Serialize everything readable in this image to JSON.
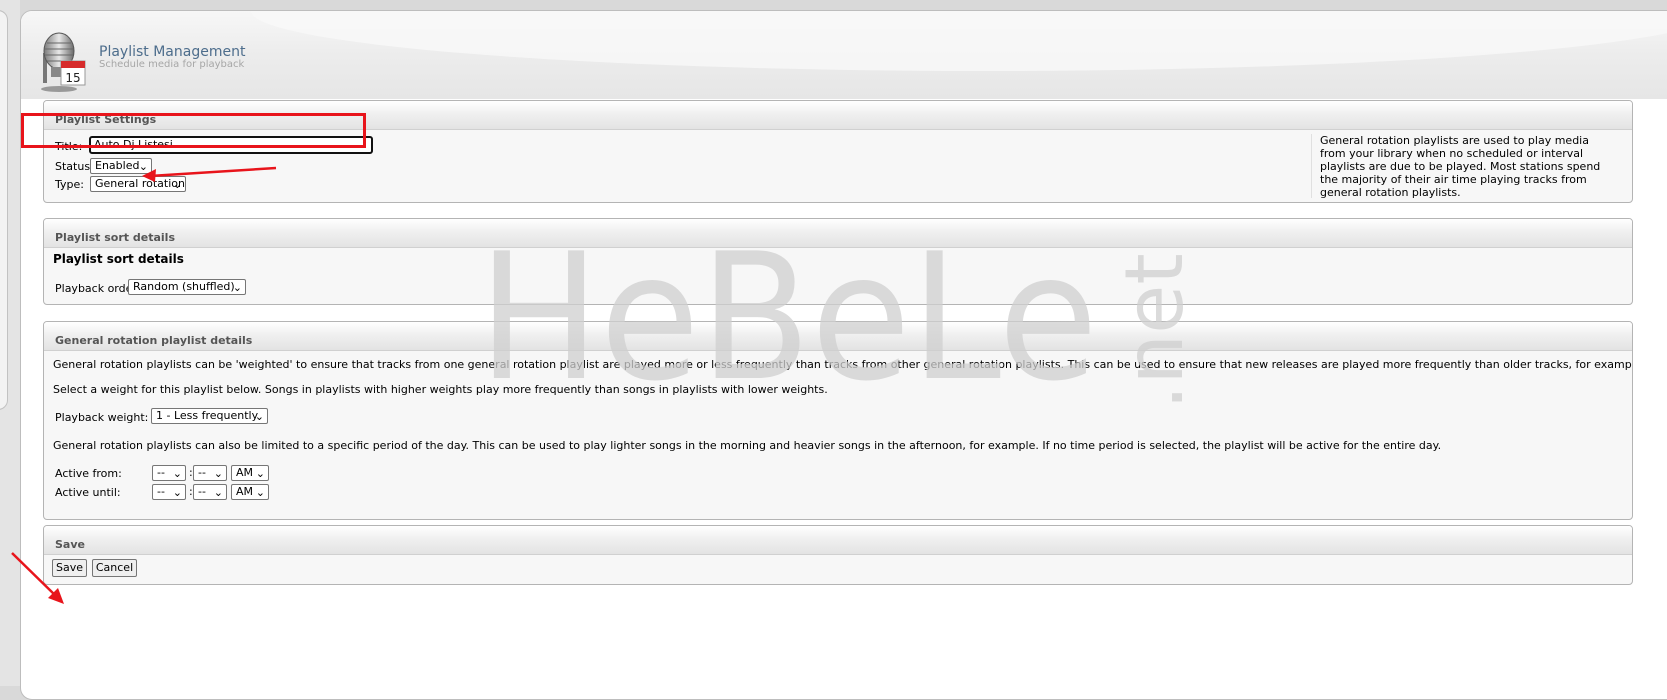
{
  "header": {
    "title": "Playlist Management",
    "subtitle": "Schedule media for playback",
    "icon_date": "15"
  },
  "settings": {
    "heading": "Playlist Settings",
    "title_label": "Title:",
    "title_value": "Auto Dj Listesi",
    "status_label": "Status:",
    "status_value": "Enabled",
    "type_label": "Type:",
    "type_value": "General rotation",
    "info_lines": [
      "General rotation playlists are used to play media",
      "from your library when no scheduled or interval",
      "playlists are due to be played. Most stations spend",
      "the majority of their air time playing tracks from",
      "general rotation playlists."
    ]
  },
  "sort": {
    "heading": "Playlist sort details",
    "subheading": "Playlist sort details",
    "order_label": "Playback order:",
    "order_value": "Random (shuffled)"
  },
  "rotation": {
    "heading": "General rotation playlist details",
    "para1": "General rotation playlists can be 'weighted' to ensure that tracks from one general rotation playlist are played more or less frequently than tracks from other general rotation playlists. This can be used to ensure that new releases are played more frequently than older tracks, for example.",
    "para2": "Select a weight for this playlist below. Songs in playlists with higher weights play more frequently than songs in playlists with lower weights.",
    "weight_label": "Playback weight:",
    "weight_value": "1 - Less frequently",
    "para3": "General rotation playlists can also be limited to a specific period of the day. This can be used to play lighter songs in the morning and heavier songs in the afternoon, for example. If no time period is selected, the playlist will be active for the entire day.",
    "from_label": "Active from:",
    "until_label": "Active until:",
    "hour_value": "--",
    "minute_value": "--",
    "ampm_value": "AM",
    "colon": ":"
  },
  "save": {
    "heading": "Save",
    "save_label": "Save",
    "cancel_label": "Cancel"
  },
  "watermark": {
    "text": "HeBeLe",
    "suffix": ".net"
  },
  "colors": {
    "annotation": "#e8141b",
    "title_blue": "#4d6d8c"
  },
  "icons": {
    "app": "microphone-calendar-icon",
    "dropdown": "chevron-down-icon"
  }
}
